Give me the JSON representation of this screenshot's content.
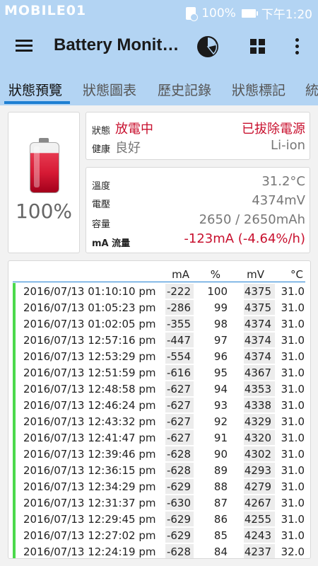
{
  "status_bar": {
    "logo": "MOBILE01",
    "battery_percent": "100%",
    "time": "下午1:20"
  },
  "app_bar": {
    "title": "Battery Monit…",
    "icons": [
      "menu-icon",
      "pie-chart-icon",
      "grid-icon",
      "more-vert-icon"
    ]
  },
  "tabs": [
    {
      "label": "狀態預覽",
      "active": true
    },
    {
      "label": "狀態圖表",
      "active": false
    },
    {
      "label": "歷史記錄",
      "active": false
    },
    {
      "label": "狀態標記",
      "active": false
    },
    {
      "label": "統",
      "active": false
    }
  ],
  "battery": {
    "percent": "100%"
  },
  "status": {
    "status_label": "狀態",
    "status_value": "放電中",
    "plug_state": "已拔除電源",
    "health_label": "健康",
    "health_value": "良好",
    "tech": "Li-ion"
  },
  "info": {
    "temp_label": "溫度",
    "temp_value": "31.2°C",
    "volt_label": "電壓",
    "volt_value": "4374mV",
    "cap_label": "容量",
    "cap_value": "2650 / 2650mAh",
    "flow_label": "mA 流量",
    "flow_value": "-123mA (-4.64%/h)"
  },
  "table": {
    "headers": {
      "ma": "mA",
      "pct": "%",
      "mv": "mV",
      "temp": "°C"
    },
    "rows": [
      [
        "2016/07/13 01:10:10 pm",
        "-222",
        "100",
        "4375",
        "31.0"
      ],
      [
        "2016/07/13 01:05:23 pm",
        "-286",
        "99",
        "4375",
        "31.0"
      ],
      [
        "2016/07/13 01:02:05 pm",
        "-355",
        "98",
        "4374",
        "31.0"
      ],
      [
        "2016/07/13 12:57:16 pm",
        "-447",
        "97",
        "4374",
        "31.0"
      ],
      [
        "2016/07/13 12:53:29 pm",
        "-554",
        "96",
        "4374",
        "31.0"
      ],
      [
        "2016/07/13 12:51:59 pm",
        "-616",
        "95",
        "4367",
        "31.0"
      ],
      [
        "2016/07/13 12:48:58 pm",
        "-627",
        "94",
        "4353",
        "31.0"
      ],
      [
        "2016/07/13 12:46:24 pm",
        "-627",
        "93",
        "4338",
        "31.0"
      ],
      [
        "2016/07/13 12:43:32 pm",
        "-627",
        "92",
        "4329",
        "31.0"
      ],
      [
        "2016/07/13 12:41:47 pm",
        "-627",
        "91",
        "4320",
        "31.0"
      ],
      [
        "2016/07/13 12:39:46 pm",
        "-628",
        "90",
        "4302",
        "31.0"
      ],
      [
        "2016/07/13 12:36:15 pm",
        "-628",
        "89",
        "4293",
        "31.0"
      ],
      [
        "2016/07/13 12:34:29 pm",
        "-629",
        "88",
        "4279",
        "31.0"
      ],
      [
        "2016/07/13 12:31:37 pm",
        "-630",
        "87",
        "4267",
        "31.0"
      ],
      [
        "2016/07/13 12:29:45 pm",
        "-629",
        "86",
        "4255",
        "31.0"
      ],
      [
        "2016/07/13 12:27:02 pm",
        "-629",
        "85",
        "4243",
        "31.0"
      ],
      [
        "2016/07/13 12:24:19 pm",
        "-628",
        "84",
        "4237",
        "32.0"
      ]
    ]
  },
  "colors": {
    "accent": "#1d7fd2",
    "bar": "#b3d4f3",
    "discharge": "#c8102e",
    "row_marker": "#4cd94c"
  }
}
